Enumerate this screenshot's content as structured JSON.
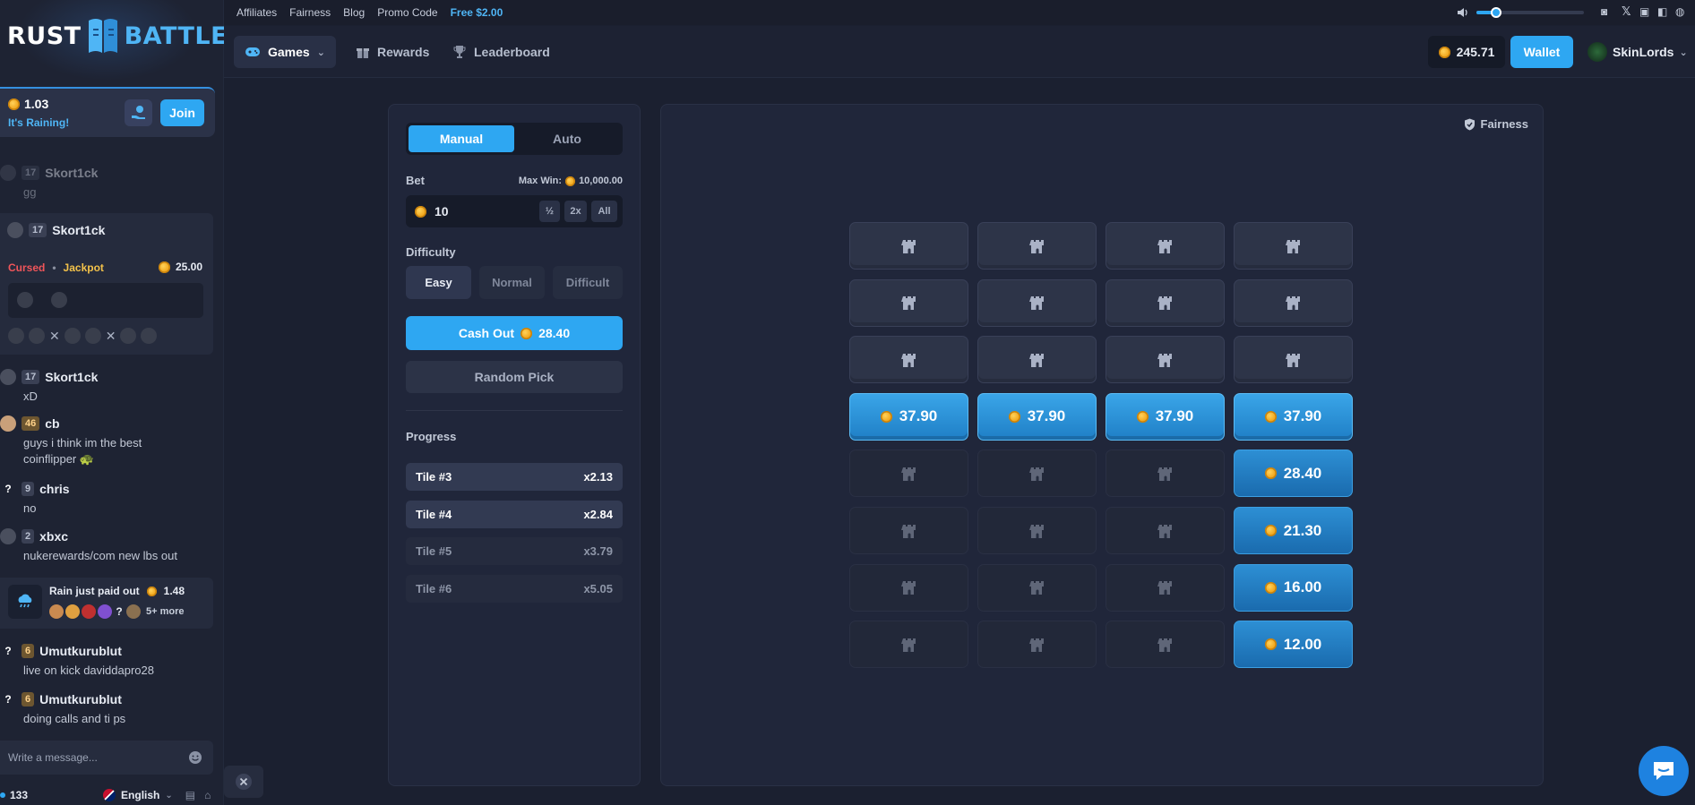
{
  "brand": {
    "left": "RUST",
    "right": "BATTLE"
  },
  "topnav": {
    "links": [
      "Affiliates",
      "Fairness",
      "Blog",
      "Promo Code"
    ],
    "free": "Free $2.00"
  },
  "mainnav": {
    "games": "Games",
    "rewards": "Rewards",
    "leaderboard": "Leaderboard"
  },
  "account": {
    "balance": "245.71",
    "wallet": "Wallet",
    "username": "SkinLords"
  },
  "rain": {
    "amount": "1.03",
    "label": "It's Raining!",
    "join": "Join"
  },
  "chat": {
    "messages": [
      {
        "user": "Skort1ck",
        "level": "17",
        "text": "gg"
      },
      {
        "user": "Skort1ck",
        "level": "17",
        "game": "Cursed",
        "type": "Jackpot",
        "amount": "25.00"
      },
      {
        "user": "Skort1ck",
        "level": "17",
        "text": "xD"
      },
      {
        "user": "cb",
        "level": "46",
        "text": "guys i think im the best coinflipper 🐢"
      },
      {
        "user": "chris",
        "level": "9",
        "text": "no"
      },
      {
        "user": "xbxc",
        "level": "2",
        "text": "nukerewards/com new lbs out"
      },
      {
        "user": "Umutkurublut",
        "level": "6",
        "text": "live on kick daviddapro28"
      },
      {
        "user": "Umutkurublut",
        "level": "6",
        "text": "doing calls and ti ps"
      }
    ],
    "rain_paid": {
      "title": "Rain just paid out",
      "amount": "1.48",
      "more": "5+ more"
    },
    "placeholder": "Write a message...",
    "online": "133",
    "language": "English"
  },
  "game": {
    "modes": {
      "manual": "Manual",
      "auto": "Auto"
    },
    "bet_label": "Bet",
    "max_win_label": "Max Win:",
    "max_win": "10,000.00",
    "bet_value": "10",
    "bet_mods": {
      "half": "½",
      "double": "2x",
      "all": "All"
    },
    "difficulty_label": "Difficulty",
    "difficulties": [
      "Easy",
      "Normal",
      "Difficult"
    ],
    "selected_difficulty": "Easy",
    "cash_out_label": "Cash Out",
    "cash_out_amount": "28.40",
    "random_pick": "Random Pick",
    "progress_label": "Progress",
    "progress": [
      {
        "tile": "Tile #3",
        "mult": "x2.13",
        "done": true
      },
      {
        "tile": "Tile #4",
        "mult": "x2.84",
        "done": true
      },
      {
        "tile": "Tile #5",
        "mult": "x3.79",
        "done": false
      },
      {
        "tile": "Tile #6",
        "mult": "x5.05",
        "done": false
      }
    ],
    "fairness": "Fairness",
    "tower_rows": [
      {
        "state": "hidden"
      },
      {
        "state": "hidden"
      },
      {
        "state": "hidden"
      },
      {
        "state": "picked",
        "value": "37.90"
      },
      {
        "state": "open",
        "value": "28.40"
      },
      {
        "state": "open",
        "value": "21.30"
      },
      {
        "state": "open",
        "value": "16.00"
      },
      {
        "state": "open",
        "value": "12.00"
      }
    ]
  }
}
